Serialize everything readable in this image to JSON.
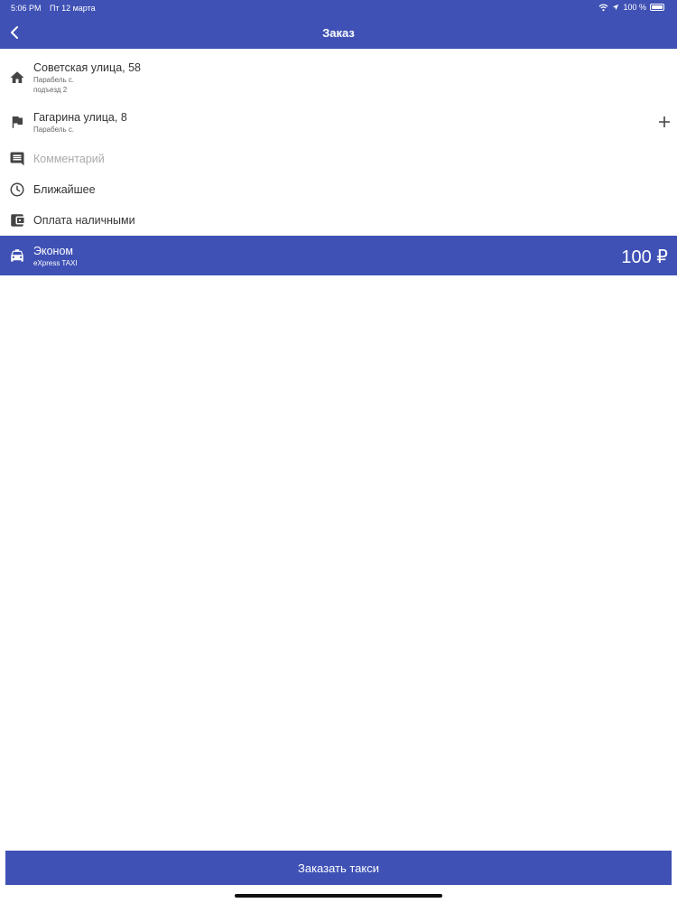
{
  "status_bar": {
    "time": "5:06 PM",
    "date": "Пт 12 марта",
    "battery_text": "100 %",
    "battery_level": 1.0,
    "icons": [
      "wifi-icon",
      "location-arrow-icon",
      "battery-icon"
    ]
  },
  "header": {
    "title": "Заказ",
    "back_icon": "chevron-left-icon",
    "background": "#3f51b5"
  },
  "route": {
    "pickup": {
      "icon": "home-icon",
      "street": "Советская улица, 58",
      "locality": "Парабель с.",
      "entrance": "подъезд 2"
    },
    "destination": {
      "icon": "flag-icon",
      "street": "Гагарина улица, 8",
      "locality": "Парабель с.",
      "add_icon": "plus-icon"
    }
  },
  "comment": {
    "icon": "comment-icon",
    "placeholder": "Комментарий"
  },
  "time_option": {
    "icon": "clock-icon",
    "label": "Ближайшее"
  },
  "payment": {
    "icon": "wallet-icon",
    "label": "Оплата наличными"
  },
  "tariff": {
    "icon": "taxi-car-icon",
    "name": "Эконом",
    "company": "eXpress TAXI",
    "price": "100 ₽"
  },
  "order_button": {
    "label": "Заказать такси"
  },
  "colors": {
    "accent": "#3f51b5",
    "text": "#333333",
    "secondary_text": "#666666",
    "placeholder": "#aaaaaa"
  }
}
